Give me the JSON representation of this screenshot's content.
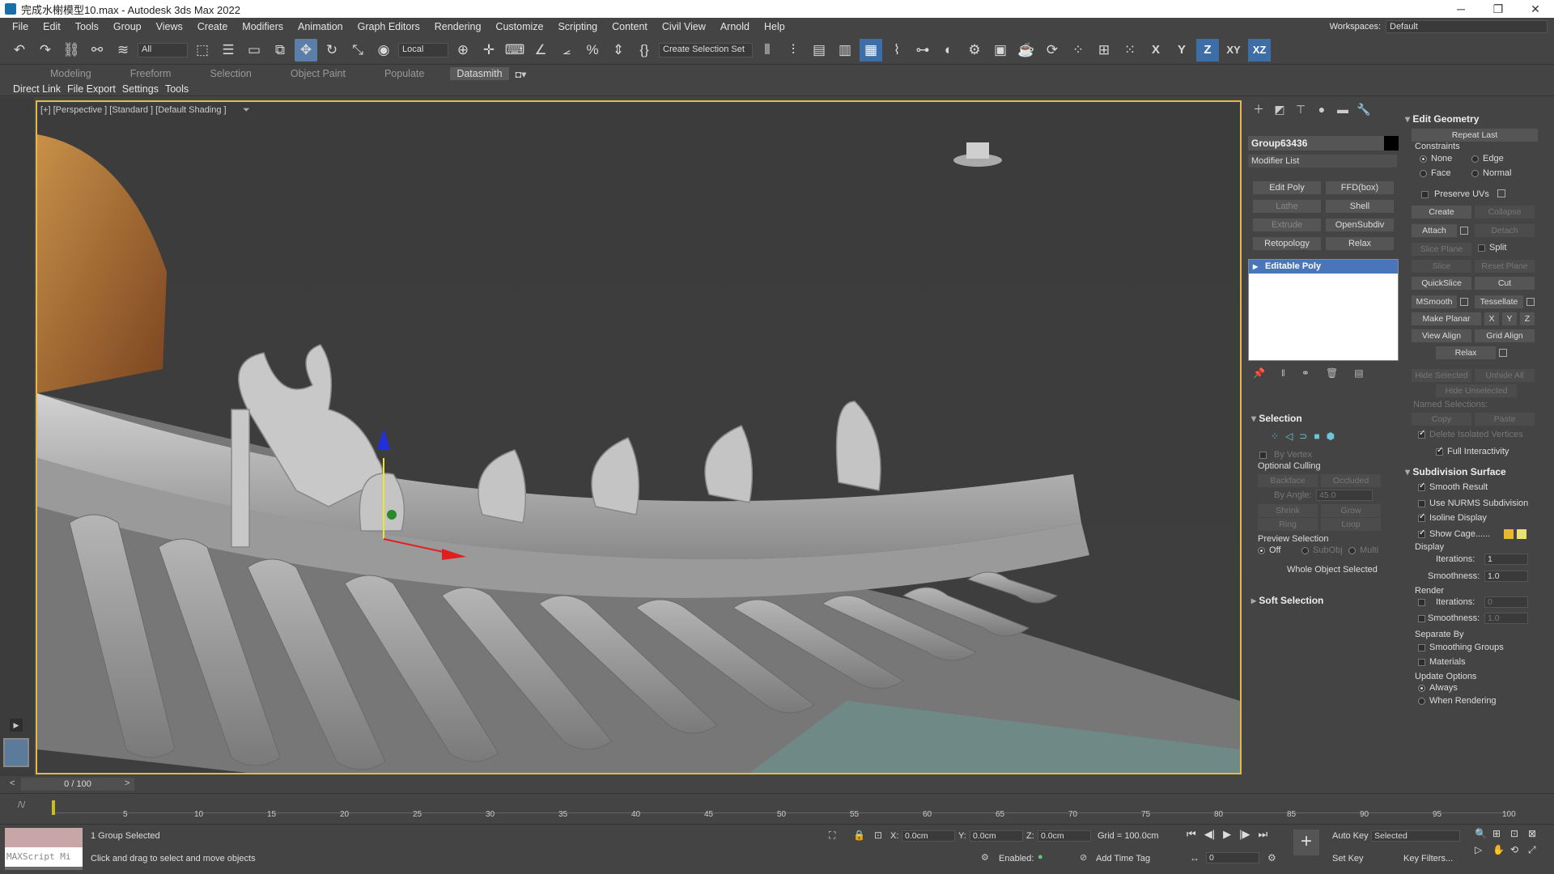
{
  "window": {
    "title": "完成水榭模型10.max - Autodesk 3ds Max 2022"
  },
  "menu": {
    "items": [
      "File",
      "Edit",
      "Tools",
      "Group",
      "Views",
      "Create",
      "Modifiers",
      "Animation",
      "Graph Editors",
      "Rendering",
      "Customize",
      "Scripting",
      "Content",
      "Civil View",
      "Arnold",
      "Help"
    ],
    "workspaces_label": "Workspaces:",
    "workspace_value": "Default"
  },
  "toolbar": {
    "filter": "All",
    "ref_coord": "Local",
    "selection_set": "Create Selection Set",
    "axis_x": "X",
    "axis_y": "Y",
    "axis_z": "Z",
    "axis_xy": "XY",
    "axis_xz": "XZ"
  },
  "ribbon_tabs": [
    "Modeling",
    "Freeform",
    "Selection",
    "Object Paint",
    "Populate",
    "Datasmith"
  ],
  "sub_tabs": [
    "Direct Link",
    "File Export",
    "Settings",
    "Tools"
  ],
  "viewport": {
    "label": "[+] [Perspective ] [Standard ] [Default Shading ]"
  },
  "command_panel": {
    "object_name": "Group63436",
    "modifier_list": "Modifier List",
    "modifier_buttons": [
      [
        "Edit Poly",
        "FFD(box)"
      ],
      [
        "Lathe",
        "Shell"
      ],
      [
        "Extrude",
        "OpenSubdiv"
      ],
      [
        "Retopology",
        "Relax"
      ]
    ],
    "stack_item": "Editable Poly",
    "selection_title": "Selection",
    "by_vertex": "By Vertex",
    "optional_culling": "Optional Culling",
    "backface": "Backface",
    "occluded": "Occluded",
    "by_angle_label": "By Angle:",
    "by_angle_value": "45.0",
    "shrink": "Shrink",
    "grow": "Grow",
    "ring": "Ring",
    "loop": "Loop",
    "preview_selection": "Preview Selection",
    "off": "Off",
    "subobj": "SubObj",
    "multi": "Multi",
    "whole_object": "Whole Object Selected",
    "soft_selection": "Soft Selection"
  },
  "edit_geometry": {
    "title": "Edit Geometry",
    "repeat_last": "Repeat Last",
    "constraints": "Constraints",
    "none": "None",
    "edge": "Edge",
    "face": "Face",
    "normal": "Normal",
    "preserve_uvs": "Preserve UVs",
    "create": "Create",
    "collapse": "Collapse",
    "attach": "Attach",
    "detach": "Detach",
    "slice_plane": "Slice Plane",
    "split": "Split",
    "slice": "Slice",
    "reset_plane": "Reset Plane",
    "quickslice": "QuickSlice",
    "cut": "Cut",
    "msmooth": "MSmooth",
    "tessellate": "Tessellate",
    "make_planar": "Make Planar",
    "x": "X",
    "y": "Y",
    "z": "Z",
    "view_align": "View Align",
    "grid_align": "Grid Align",
    "relax": "Relax",
    "hide_selected": "Hide Selected",
    "unhide_all": "Unhide All",
    "hide_unselected": "Hide Unselected",
    "named_selections": "Named Selections:",
    "copy": "Copy",
    "paste": "Paste",
    "delete_isolated": "Delete Isolated Vertices",
    "full_interactivity": "Full Interactivity"
  },
  "subdivision": {
    "title": "Subdivision Surface",
    "smooth_result": "Smooth Result",
    "use_nurms": "Use NURMS Subdivision",
    "isoline": "Isoline Display",
    "show_cage": "Show Cage......",
    "display": "Display",
    "iterations_label": "Iterations:",
    "display_iterations": "1",
    "smoothness_label": "Smoothness:",
    "display_smoothness": "1.0",
    "render": "Render",
    "render_iterations": "0",
    "render_smoothness": "1.0",
    "separate_by": "Separate By",
    "smoothing_groups": "Smoothing Groups",
    "materials": "Materials",
    "update_options": "Update Options",
    "always": "Always",
    "when_rendering": "When Rendering",
    "cage_color1": "#e8b830",
    "cage_color2": "#e8e070"
  },
  "timeline": {
    "slider": "0 / 100",
    "ticks": [
      "5",
      "10",
      "15",
      "20",
      "25",
      "30",
      "35",
      "40",
      "45",
      "50",
      "55",
      "60",
      "65",
      "70",
      "75",
      "80",
      "85",
      "90",
      "95",
      "100"
    ]
  },
  "status": {
    "maxscript": "MAXScript Mi",
    "selected": "1 Group Selected",
    "prompt": "Click and drag to select and move objects",
    "x_label": "X:",
    "x_value": "0.0cm",
    "y_label": "Y:",
    "y_value": "0.0cm",
    "z_label": "Z:",
    "z_value": "0.0cm",
    "grid": "Grid = 100.0cm",
    "enabled": "Enabled:",
    "add_time_tag": "Add Time Tag",
    "auto_key": "Auto Key",
    "set_key": "Set Key",
    "key_mode": "Selected",
    "key_filters": "Key Filters...",
    "frame": "0"
  }
}
